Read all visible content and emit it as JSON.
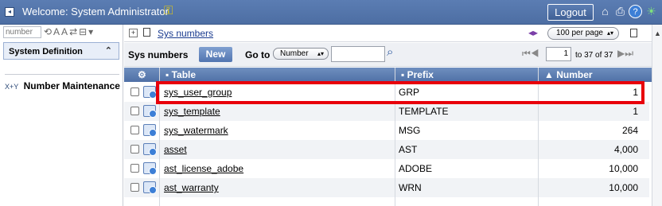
{
  "header": {
    "title": "Welcome: System Administrator",
    "logout_label": "Logout"
  },
  "leftnav": {
    "filter_placeholder": "number",
    "icon_glyphs": "⟲AA⇄⊟▾",
    "section_title": "System Definition",
    "item_label": "Number Maintenance",
    "item_icon_text": "X+Y"
  },
  "breadcrumb": {
    "link": "Sys numbers",
    "per_page": "100 per page"
  },
  "toolbar": {
    "list_label": "Sys numbers",
    "new_label": "New",
    "goto_label": "Go to",
    "goto_field": "Number",
    "page_value": "1",
    "page_text": "to 37 of 37"
  },
  "table": {
    "columns": [
      "Table",
      "Prefix",
      "Number"
    ],
    "rows": [
      {
        "table": "sys_user_group",
        "prefix": "GRP",
        "number": "1"
      },
      {
        "table": "sys_template",
        "prefix": "TEMPLATE",
        "number": "1"
      },
      {
        "table": "sys_watermark",
        "prefix": "MSG",
        "number": "264"
      },
      {
        "table": "asset",
        "prefix": "AST",
        "number": "4,000"
      },
      {
        "table": "ast_license_adobe",
        "prefix": "ADOBE",
        "number": "10,000"
      },
      {
        "table": "ast_warranty",
        "prefix": "WRN",
        "number": "10,000"
      }
    ]
  },
  "colors": {
    "header_blue": "#5b7db3",
    "highlight_red": "#e8000b"
  }
}
